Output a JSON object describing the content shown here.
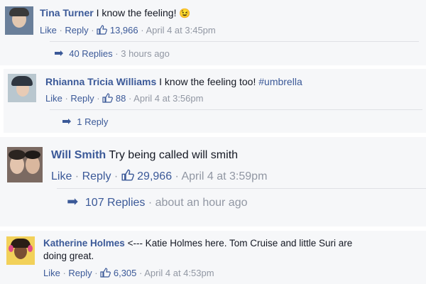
{
  "comments": [
    {
      "name": "Tina Turner",
      "text": "I know the feeling!",
      "emoji": "😉",
      "like_label": "Like",
      "reply_label": "Reply",
      "likes": "13,966",
      "time": "April 4 at 3:45pm",
      "replies_label": "40 Replies",
      "replies_time": "3 hours ago"
    },
    {
      "name": "Rhianna Tricia Williams",
      "text": "I know the feeling too!",
      "hashtag": "#umbrella",
      "like_label": "Like",
      "reply_label": "Reply",
      "likes": "88",
      "time": "April 4 at 3:56pm",
      "replies_label": "1 Reply"
    },
    {
      "name": "Will Smith",
      "text": "Try being called will smith",
      "like_label": "Like",
      "reply_label": "Reply",
      "likes": "29,966",
      "time": "April 4 at 3:59pm",
      "replies_label": "107 Replies",
      "replies_time": "about an hour ago"
    },
    {
      "name": "Katherine Holmes",
      "text_line1": "<--- Katie Holmes here. Tom Cruise and little Suri are",
      "text_line2": "doing great.",
      "like_label": "Like",
      "reply_label": "Reply",
      "likes": "6,305",
      "time": "April 4 at 4:53pm"
    }
  ],
  "colors": {
    "link": "#3b5998",
    "muted": "#9197a3",
    "text": "#141823",
    "strip": "#f6f7f9"
  },
  "icons": {
    "like": "thumbs-up-icon",
    "reply_arrow": "reply-arrow-icon"
  }
}
